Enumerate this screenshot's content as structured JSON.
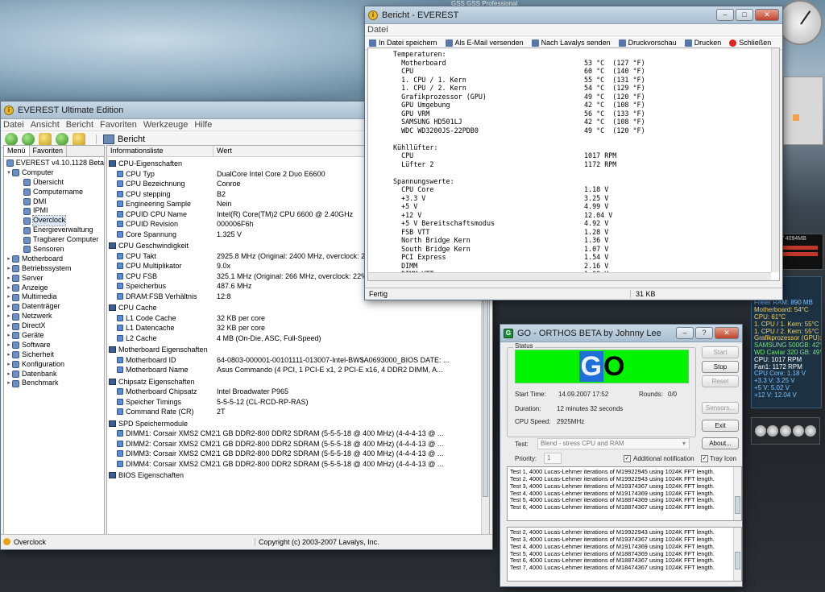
{
  "desktop": {
    "top_strip": "GSS    GSS          Professional",
    "mem_gadget": "8 / 4094MB",
    "stats_lines": [
      {
        "t": "26 MHz",
        "c": "#7ec4ff"
      },
      {
        "t": "ator: 9.0x",
        "c": "#7ec4ff"
      },
      {
        "t": " MHz",
        "c": "#7ec4ff"
      },
      {
        "t": "Freier RAM: 890 MB",
        "c": "#7ec4ff"
      },
      {
        "t": "Motherboard: 54°C",
        "c": "#f0d26a"
      },
      {
        "t": "CPU: 61°C",
        "c": "#f0d26a"
      },
      {
        "t": "1. CPU / 1. Kern: 55°C",
        "c": "#f0d26a"
      },
      {
        "t": "1. CPU / 2. Kern: 55°C",
        "c": "#f0d26a"
      },
      {
        "t": "Grafikprozessor (GPU): 49°C",
        "c": "#f0d26a"
      },
      {
        "t": "SAMSUNG 500GB: 42°C",
        "c": "#7ee07e"
      },
      {
        "t": "WD Caviar 320 GB: 49°C",
        "c": "#7ee07e"
      },
      {
        "t": "CPU: 1017 RPM",
        "c": "#ffffff"
      },
      {
        "t": "Fan1: 1172 RPM",
        "c": "#ffffff"
      },
      {
        "t": "CPU Core: 1.18 V",
        "c": "#7ec4ff"
      },
      {
        "t": "+3.3 V: 3.25 V",
        "c": "#7ec4ff"
      },
      {
        "t": "+5 V: 5.02 V",
        "c": "#7ec4ff"
      },
      {
        "t": "+12 V: 12.04 V",
        "c": "#7ec4ff"
      }
    ]
  },
  "everest": {
    "title": "EVEREST Ultimate Edition",
    "menu": [
      "Datei",
      "Ansicht",
      "Bericht",
      "Favoriten",
      "Werkzeuge",
      "Hilfe"
    ],
    "toolbar_report": "Bericht",
    "tabs": [
      "Menü",
      "Favoriten"
    ],
    "tree": [
      {
        "label": "EVEREST v4.10.1128 Beta",
        "lvl": 0,
        "ex": ""
      },
      {
        "label": "Computer",
        "lvl": 0,
        "ex": "▾"
      },
      {
        "label": "Übersicht",
        "lvl": 1,
        "ex": ""
      },
      {
        "label": "Computername",
        "lvl": 1,
        "ex": ""
      },
      {
        "label": "DMI",
        "lvl": 1,
        "ex": ""
      },
      {
        "label": "IPMI",
        "lvl": 1,
        "ex": ""
      },
      {
        "label": "Overclock",
        "lvl": 1,
        "ex": "",
        "sel": true
      },
      {
        "label": "Energieverwaltung",
        "lvl": 1,
        "ex": ""
      },
      {
        "label": "Tragbarer Computer",
        "lvl": 1,
        "ex": ""
      },
      {
        "label": "Sensoren",
        "lvl": 1,
        "ex": ""
      },
      {
        "label": "Motherboard",
        "lvl": 0,
        "ex": "▸"
      },
      {
        "label": "Betriebssystem",
        "lvl": 0,
        "ex": "▸"
      },
      {
        "label": "Server",
        "lvl": 0,
        "ex": "▸"
      },
      {
        "label": "Anzeige",
        "lvl": 0,
        "ex": "▸"
      },
      {
        "label": "Multimedia",
        "lvl": 0,
        "ex": "▸"
      },
      {
        "label": "Datenträger",
        "lvl": 0,
        "ex": "▸"
      },
      {
        "label": "Netzwerk",
        "lvl": 0,
        "ex": "▸"
      },
      {
        "label": "DirectX",
        "lvl": 0,
        "ex": "▸"
      },
      {
        "label": "Geräte",
        "lvl": 0,
        "ex": "▸"
      },
      {
        "label": "Software",
        "lvl": 0,
        "ex": "▸"
      },
      {
        "label": "Sicherheit",
        "lvl": 0,
        "ex": "▸"
      },
      {
        "label": "Konfiguration",
        "lvl": 0,
        "ex": "▸"
      },
      {
        "label": "Datenbank",
        "lvl": 0,
        "ex": "▸"
      },
      {
        "label": "Benchmark",
        "lvl": 0,
        "ex": "▸"
      }
    ],
    "columns": [
      "Informationsliste",
      "Wert"
    ],
    "sections": [
      {
        "title": "CPU-Eigenschaften",
        "rows": [
          [
            "CPU Typ",
            "DualCore Intel Core 2 Duo E6600"
          ],
          [
            "CPU Bezeichnung",
            "Conroe"
          ],
          [
            "CPU stepping",
            "B2"
          ],
          [
            "Engineering Sample",
            "Nein"
          ],
          [
            "CPUID CPU Name",
            "Intel(R) Core(TM)2 CPU 6600 @ 2.40GHz"
          ],
          [
            "CPUID Revision",
            "000006F6h"
          ],
          [
            "Core Spannung",
            "1.325 V"
          ]
        ]
      },
      {
        "title": "CPU Geschwindigkeit",
        "rows": [
          [
            "CPU Takt",
            "2925.8 MHz  (Original: 2400 MHz, overclock: 22%)"
          ],
          [
            "CPU Multiplikator",
            "9.0x"
          ],
          [
            "CPU FSB",
            "325.1 MHz  (Original: 266 MHz, overclock: 22%)"
          ],
          [
            "Speicherbus",
            "487.6 MHz"
          ],
          [
            "DRAM:FSB Verhältnis",
            "12:8"
          ]
        ]
      },
      {
        "title": "CPU Cache",
        "rows": [
          [
            "L1 Code Cache",
            "32 KB per core"
          ],
          [
            "L1 Datencache",
            "32 KB per core"
          ],
          [
            "L2 Cache",
            "4 MB  (On-Die, ASC, Full-Speed)"
          ]
        ]
      },
      {
        "title": "Motherboard Eigenschaften",
        "rows": [
          [
            "Motherboard ID",
            "64-0803-000001-00101111-013007-Intel-BW$A0693000_BIOS DATE: ..."
          ],
          [
            "Motherboard Name",
            "Asus Commando  (4 PCI, 1 PCI-E x1, 2 PCI-E x16, 4 DDR2 DIMM, A..."
          ]
        ]
      },
      {
        "title": "Chipsatz Eigenschaften",
        "rows": [
          [
            "Motherboard Chipsatz",
            "Intel Broadwater P965"
          ],
          [
            "Speicher Timings",
            "5-5-5-12  (CL-RCD-RP-RAS)"
          ],
          [
            "Command Rate (CR)",
            "2T"
          ]
        ]
      },
      {
        "title": "SPD Speichermodule",
        "rows": [
          [
            "DIMM1: Corsair XMS2 CM2X...",
            "1 GB DDR2-800 DDR2 SDRAM  (5-5-5-18 @ 400 MHz)  (4-4-4-13 @ ..."
          ],
          [
            "DIMM2: Corsair XMS2 CM2X...",
            "1 GB DDR2-800 DDR2 SDRAM  (5-5-5-18 @ 400 MHz)  (4-4-4-13 @ ..."
          ],
          [
            "DIMM3: Corsair XMS2 CM2X...",
            "1 GB DDR2-800 DDR2 SDRAM  (5-5-5-18 @ 400 MHz)  (4-4-4-13 @ ..."
          ],
          [
            "DIMM4: Corsair XMS2 CM2X...",
            "1 GB DDR2-800 DDR2 SDRAM  (5-5-5-18 @ 400 MHz)  (4-4-4-13 @ ..."
          ]
        ]
      },
      {
        "title": "BIOS Eigenschaften",
        "rows": []
      }
    ],
    "status_left": "Overclock",
    "status_right": "Copyright (c) 2003-2007 Lavalys, Inc."
  },
  "bericht": {
    "title": "Bericht - EVEREST",
    "menu": [
      "Datei"
    ],
    "toolbar": [
      {
        "label": "In Datei speichern",
        "icon": "save-icon"
      },
      {
        "label": "Als E-Mail versenden",
        "icon": "mail-icon"
      },
      {
        "label": "Nach Lavalys senden",
        "icon": "globe-icon"
      },
      {
        "label": "Druckvorschau",
        "icon": "preview-icon"
      },
      {
        "label": "Drucken",
        "icon": "print-icon"
      },
      {
        "label": "Schließen",
        "icon": "close-icon"
      }
    ],
    "report_text": "Temperaturen:\n  Motherboard                                  53 °C  (127 °F)\n  CPU                                          60 °C  (140 °F)\n  1. CPU / 1. Kern                             55 °C  (131 °F)\n  1. CPU / 2. Kern                             54 °C  (129 °F)\n  Grafikprozessor (GPU)                        49 °C  (120 °F)\n  GPU Umgebung                                 42 °C  (108 °F)\n  GPU VRM                                      56 °C  (133 °F)\n  SAMSUNG HD501LJ                              42 °C  (108 °F)\n  WDC WD3200JS-22PDB0                          49 °C  (120 °F)\n\nKühllüfter:\n  CPU                                          1017 RPM\n  Lüfter 2                                     1172 RPM\n\nSpannungswerte:\n  CPU Core                                     1.18 V\n  +3.3 V                                       3.25 V\n  +5 V                                         4.99 V\n  +12 V                                        12.04 V\n  +5 V Bereitschaftsmodus                      4.92 V\n  FSB VTT                                      1.28 V\n  North Bridge Kern                            1.36 V\n  South Bridge Kern                            1.07 V\n  PCI Express                                  1.54 V\n  DIMM                                         2.16 V\n  DIMM VTT                                     1.09 V",
    "status_left": "Fertig",
    "status_right": "31 KB"
  },
  "orthos": {
    "title": "GO - ORTHOS BETA by Johnny Lee",
    "status_group": "Status",
    "banner_g": "G",
    "banner_o": "O",
    "start_time_label": "Start Time:",
    "start_time": "14.09.2007 17:52",
    "rounds_label": "Rounds:",
    "rounds": "0/0",
    "duration_label": "Duration:",
    "duration": "12 minutes 32 seconds",
    "cpu_speed_label": "CPU Speed:",
    "cpu_speed": "2925MHz",
    "buttons": {
      "start": "Start",
      "stop": "Stop",
      "reset": "Reset",
      "sensors": "Sensors...",
      "exit": "Exit",
      "about": "About..."
    },
    "test_label": "Test:",
    "test_value": "Blend - stress CPU and RAM",
    "priority_label": "Priority:",
    "priority_value": "1",
    "additional_notification": "Additional notification",
    "tray_icon": "Tray Icon",
    "log1": [
      "Test 1, 4000 Lucas-Lehmer iterations of M19922945 using 1024K FFT length.",
      "Test 2, 4000 Lucas-Lehmer iterations of M19922943 using 1024K FFT length.",
      "Test 3, 4000 Lucas-Lehmer iterations of M19374367 using 1024K FFT length.",
      "Test 4, 4000 Lucas-Lehmer iterations of M19174369 using 1024K FFT length.",
      "Test 5, 4000 Lucas-Lehmer iterations of M18874369 using 1024K FFT length.",
      "Test 6, 4000 Lucas-Lehmer iterations of M18874367 using 1024K FFT length."
    ],
    "log2": [
      "Test 2, 4000 Lucas-Lehmer iterations of M19922943 using 1024K FFT length.",
      "Test 3, 4000 Lucas-Lehmer iterations of M19374367 using 1024K FFT length.",
      "Test 4, 4000 Lucas-Lehmer iterations of M19174369 using 1024K FFT length.",
      "Test 5, 4000 Lucas-Lehmer iterations of M18874369 using 1024K FFT length.",
      "Test 6, 4000 Lucas-Lehmer iterations of M18874367 using 1024K FFT length.",
      "Test 7, 4000 Lucas-Lehmer iterations of M18474367 using 1024K FFT length."
    ]
  }
}
